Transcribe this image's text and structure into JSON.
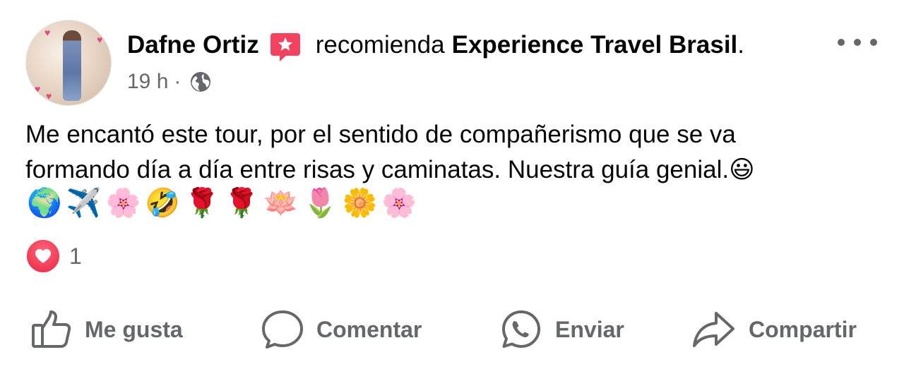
{
  "post": {
    "author": "Dafne Ortiz",
    "action_text": "recomienda",
    "page_name": "Experience Travel Brasil",
    "page_suffix": ".",
    "time": "19 h",
    "separator": "·",
    "privacy_icon": "globe-icon",
    "recommend_icon": "star-speech-bubble-icon",
    "text_line_1": "Me encantó este tour, por el sentido de compañerismo  que se va",
    "text_line_2": "formando  día a día entre risas y caminatas. Nuestra guía genial.",
    "text_line_2_emoji": "😃",
    "emoji_row": "🌍✈️🌸🤣🌹🌹🪷🌷🌼🌸"
  },
  "reactions": {
    "icon": "love-reaction-icon",
    "count": "1"
  },
  "actions": {
    "like": "Me gusta",
    "comment": "Comentar",
    "send": "Enviar",
    "share": "Compartir"
  },
  "colors": {
    "text_primary": "#050505",
    "text_secondary": "#65676b",
    "recommend_badge": "#f3425f",
    "love_reaction": "#f33e58"
  }
}
